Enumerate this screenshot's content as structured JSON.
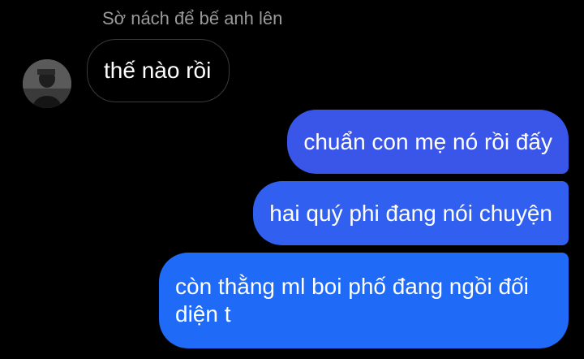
{
  "thread": {
    "reply_caption": "Sờ nách để bế anh lên",
    "messages": [
      {
        "direction": "incoming",
        "text": "thế nào rồi"
      },
      {
        "direction": "outgoing",
        "text": "chuẩn con mẹ nó rồi đấy"
      },
      {
        "direction": "outgoing",
        "text": "hai quý phi đang nói chuyện"
      },
      {
        "direction": "outgoing",
        "text": "còn thằng ml boi phố đang ngồi đối diện t"
      }
    ]
  },
  "colors": {
    "background": "#000000",
    "incoming_bubble_border": "#3a3a3a",
    "outgoing_bubble_top": "#3a56e8",
    "outgoing_bubble_mid": "#3160f0",
    "outgoing_bubble_bottom": "#1f6af6",
    "caption_text": "#9a9a9a"
  },
  "icons": {
    "avatar": "profile-photo"
  }
}
